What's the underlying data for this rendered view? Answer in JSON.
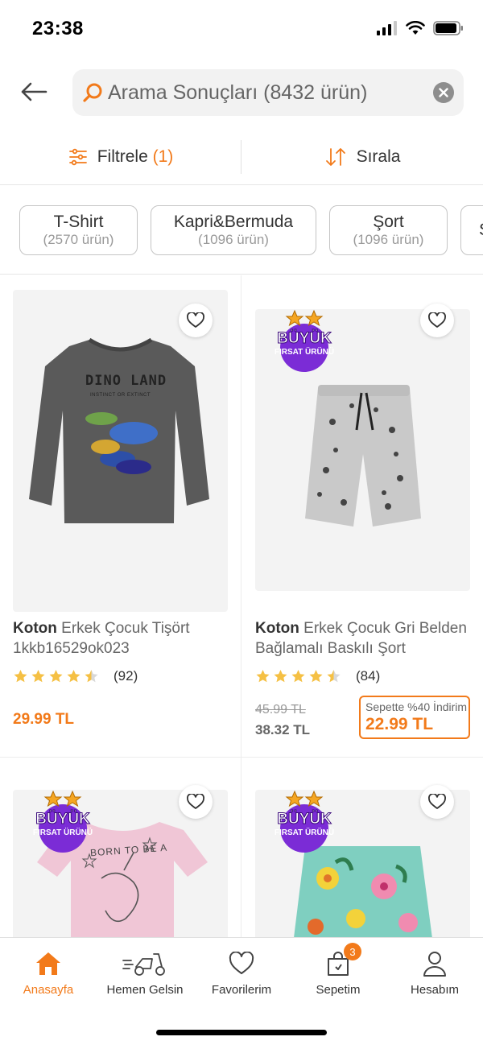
{
  "status_bar": {
    "time": "23:38"
  },
  "search": {
    "text": "Arama Sonuçları (8432 ürün)"
  },
  "toolbar": {
    "filter_label": "Filtrele",
    "filter_count": "(1)",
    "sort_label": "Sırala"
  },
  "chips": [
    {
      "title": "T-Shirt",
      "count": "(2570 ürün)"
    },
    {
      "title": "Kapri&Bermuda",
      "count": "(1096 ürün)"
    },
    {
      "title": "Şort",
      "count": "(1096 ürün)"
    },
    {
      "title": "S",
      "count": ""
    }
  ],
  "products": [
    {
      "brand": "Koton",
      "name": "Erkek Çocuk Tişört 1kkb16529ok023",
      "rating": 4.5,
      "reviews": "(92)",
      "price": "29.99 TL",
      "image_text": "DINO LAND",
      "image_subtext": "INSTINCT OR EXTINCT"
    },
    {
      "brand": "Koton",
      "name": "Erkek Çocuk Gri Belden Bağlamalı Baskılı Şort",
      "rating": 4.5,
      "reviews": "(84)",
      "old_price": "45.99 TL",
      "price": "38.32 TL",
      "promo_label": "Sepette %40 İndirim",
      "promo_price": "22.99 TL",
      "badge_line1": "BÜYÜK",
      "badge_line2": "FIRSAT ÜRÜNÜ"
    },
    {
      "badge_line1": "BÜYÜK",
      "badge_line2": "FIRSAT ÜRÜNÜ",
      "image_text": "BORN TO BE A"
    },
    {
      "badge_line1": "BÜYÜK",
      "badge_line2": "FIRSAT ÜRÜNÜ"
    }
  ],
  "bottom_nav": [
    {
      "label": "Anasayfa",
      "icon": "home-icon",
      "active": true
    },
    {
      "label": "Hemen Gelsin",
      "icon": "scooter-icon"
    },
    {
      "label": "Favorilerim",
      "icon": "heart-icon"
    },
    {
      "label": "Sepetim",
      "icon": "bag-icon",
      "badge": "3"
    },
    {
      "label": "Hesabım",
      "icon": "user-icon"
    }
  ],
  "colors": {
    "accent": "#f27a1a",
    "badge_purple": "#7b2cd6",
    "star": "#f5c044"
  }
}
